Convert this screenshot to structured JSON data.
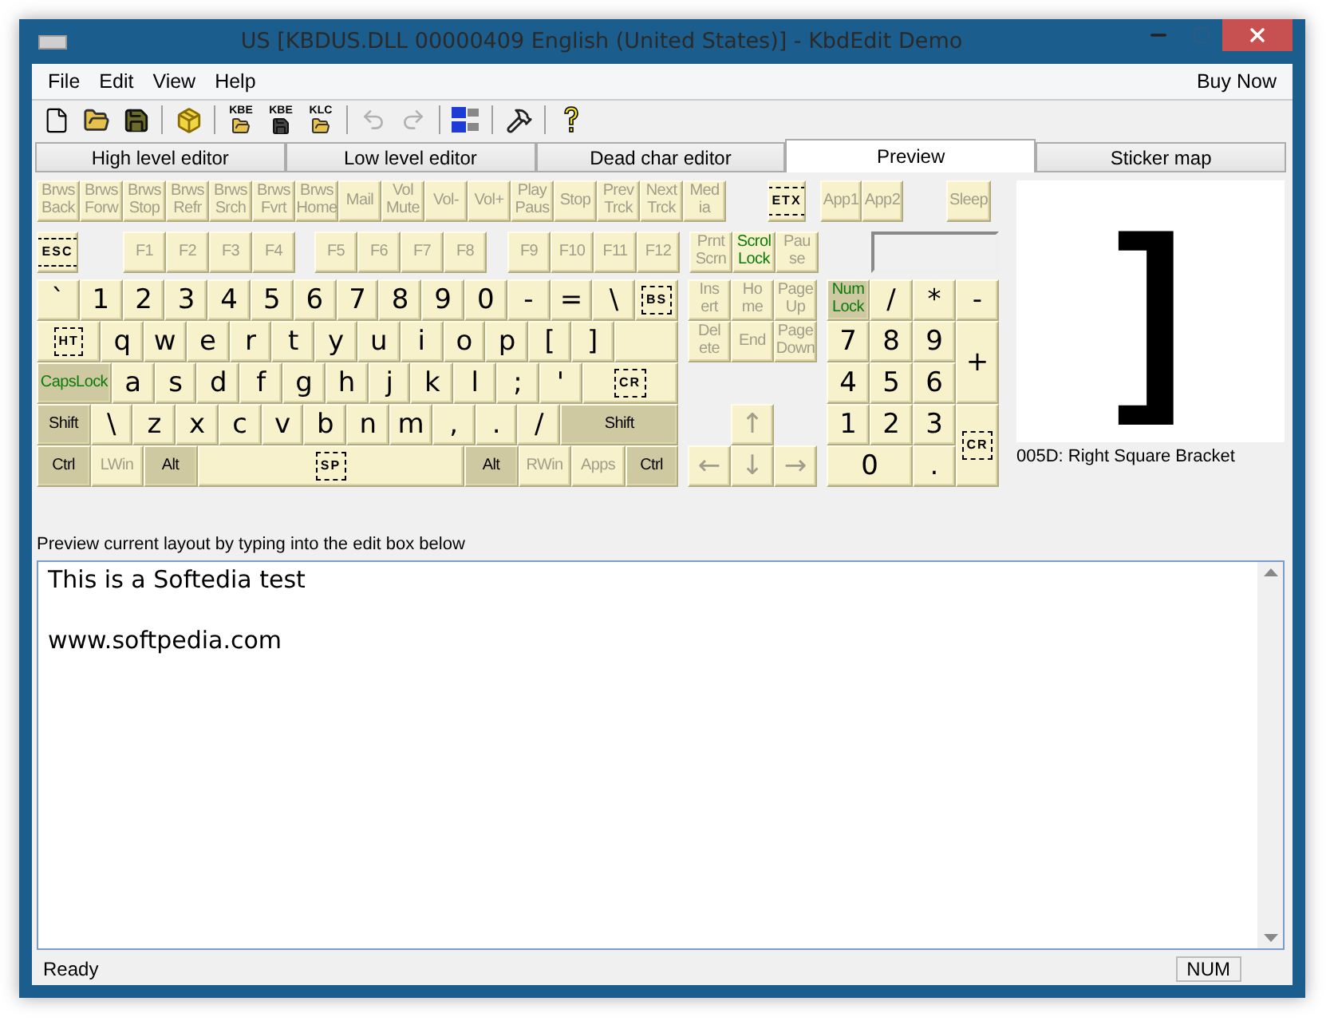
{
  "window": {
    "title": "US [KBDUS.DLL 00000409 English (United States)] - KbdEdit Demo"
  },
  "menu": [
    {
      "label": "File"
    },
    {
      "label": "Edit"
    },
    {
      "label": "View"
    },
    {
      "label": "Help"
    }
  ],
  "buy_now": "Buy Now",
  "toolbar": [
    {
      "kind": "new",
      "disabled": false
    },
    {
      "kind": "open",
      "disabled": false
    },
    {
      "kind": "save",
      "disabled": false
    },
    {
      "kind": "separator"
    },
    {
      "kind": "package",
      "disabled": false
    },
    {
      "kind": "separator"
    },
    {
      "kind": "file-open",
      "label": "KBE",
      "disabled": false
    },
    {
      "kind": "file-save",
      "label": "KBE",
      "disabled": false
    },
    {
      "kind": "file-open",
      "label": "KLC",
      "disabled": false
    },
    {
      "kind": "separator"
    },
    {
      "kind": "undo",
      "disabled": true
    },
    {
      "kind": "redo",
      "disabled": true
    },
    {
      "kind": "separator"
    },
    {
      "kind": "language",
      "disabled": false
    },
    {
      "kind": "separator"
    },
    {
      "kind": "tools",
      "disabled": false
    },
    {
      "kind": "separator"
    },
    {
      "kind": "help",
      "disabled": false
    }
  ],
  "tabs": [
    {
      "label": "High level editor",
      "selected": false
    },
    {
      "label": "Low level editor",
      "selected": false
    },
    {
      "label": "Dead char editor",
      "selected": false
    },
    {
      "label": "Preview",
      "selected": true
    },
    {
      "label": "Sticker map",
      "selected": false
    }
  ],
  "keyboard": {
    "media_row": [
      {
        "label": "Brws Back",
        "kind": "named",
        "dim": true
      },
      {
        "label": "Brws Forw",
        "kind": "named",
        "dim": true
      },
      {
        "label": "Brws Stop",
        "kind": "named",
        "dim": true
      },
      {
        "label": "Brws Refr",
        "kind": "named",
        "dim": true
      },
      {
        "label": "Brws Srch",
        "kind": "named",
        "dim": true
      },
      {
        "label": "Brws Fvrt",
        "kind": "named",
        "dim": true
      },
      {
        "label": "Brws Home",
        "kind": "named",
        "dim": true
      },
      {
        "label": "Mail",
        "kind": "named",
        "dim": true
      },
      {
        "label": "Vol Mute",
        "kind": "named",
        "dim": true
      },
      {
        "label": "Vol-",
        "kind": "named",
        "dim": true
      },
      {
        "label": "Vol+",
        "kind": "named",
        "dim": true
      },
      {
        "label": "Play Paus",
        "kind": "named",
        "dim": true
      },
      {
        "label": "Stop",
        "kind": "named",
        "dim": true
      },
      {
        "label": "Prev Trck",
        "kind": "named",
        "dim": true
      },
      {
        "label": "Next Trck",
        "kind": "named",
        "dim": true
      },
      {
        "label": "Med ia",
        "kind": "named",
        "dim": true
      },
      {
        "label": "ETX",
        "kind": "control",
        "dim": false
      },
      {
        "label": "App1",
        "kind": "named",
        "dim": true
      },
      {
        "label": "App2",
        "kind": "named",
        "dim": true
      },
      {
        "label": "Sleep",
        "kind": "named",
        "dim": true
      }
    ],
    "function_row": [
      {
        "label": "ESC",
        "kind": "control",
        "dim": false
      },
      {
        "label": "F1",
        "kind": "named",
        "dim": true
      },
      {
        "label": "F2",
        "kind": "named",
        "dim": true
      },
      {
        "label": "F3",
        "kind": "named",
        "dim": true
      },
      {
        "label": "F4",
        "kind": "named",
        "dim": true
      },
      {
        "label": "F5",
        "kind": "named",
        "dim": true
      },
      {
        "label": "F6",
        "kind": "named",
        "dim": true
      },
      {
        "label": "F7",
        "kind": "named",
        "dim": true
      },
      {
        "label": "F8",
        "kind": "named",
        "dim": true
      },
      {
        "label": "F9",
        "kind": "named",
        "dim": true
      },
      {
        "label": "F10",
        "kind": "named",
        "dim": true
      },
      {
        "label": "F11",
        "kind": "named",
        "dim": true
      },
      {
        "label": "F12",
        "kind": "named",
        "dim": true
      },
      {
        "label": "Prnt Scrn",
        "kind": "named",
        "dim": true
      },
      {
        "label": "Scrol Lock",
        "kind": "named",
        "dim": false,
        "lit": true
      },
      {
        "label": "Pau se",
        "kind": "named",
        "dim": true
      }
    ],
    "main_rows": [
      [
        {
          "label": "`",
          "kind": "char",
          "dim": false
        },
        {
          "label": "1",
          "kind": "char",
          "dim": false
        },
        {
          "label": "2",
          "kind": "char",
          "dim": false
        },
        {
          "label": "3",
          "kind": "char",
          "dim": false
        },
        {
          "label": "4",
          "kind": "char",
          "dim": false
        },
        {
          "label": "5",
          "kind": "char",
          "dim": false
        },
        {
          "label": "6",
          "kind": "char",
          "dim": false
        },
        {
          "label": "7",
          "kind": "char",
          "dim": false
        },
        {
          "label": "8",
          "kind": "char",
          "dim": false
        },
        {
          "label": "9",
          "kind": "char",
          "dim": false
        },
        {
          "label": "0",
          "kind": "char",
          "dim": false
        },
        {
          "label": "-",
          "kind": "char",
          "dim": false
        },
        {
          "label": "=",
          "kind": "char",
          "dim": false
        },
        {
          "label": "\\",
          "kind": "char",
          "dim": false
        },
        {
          "label": "BS",
          "kind": "control",
          "dim": false
        }
      ],
      [
        {
          "label": "HT",
          "kind": "control",
          "dim": false
        },
        {
          "label": "q",
          "kind": "char",
          "dim": false
        },
        {
          "label": "w",
          "kind": "char",
          "dim": false
        },
        {
          "label": "e",
          "kind": "char",
          "dim": false
        },
        {
          "label": "r",
          "kind": "char",
          "dim": false
        },
        {
          "label": "t",
          "kind": "char",
          "dim": false
        },
        {
          "label": "y",
          "kind": "char",
          "dim": false
        },
        {
          "label": "u",
          "kind": "char",
          "dim": false
        },
        {
          "label": "i",
          "kind": "char",
          "dim": false
        },
        {
          "label": "o",
          "kind": "char",
          "dim": false
        },
        {
          "label": "p",
          "kind": "char",
          "dim": false
        },
        {
          "label": "[",
          "kind": "char",
          "dim": false
        },
        {
          "label": "]",
          "kind": "char",
          "dim": false
        }
      ],
      [
        {
          "label": "CapsLock",
          "kind": "modifier",
          "dim": false,
          "lit": true
        },
        {
          "label": "a",
          "kind": "char",
          "dim": false
        },
        {
          "label": "s",
          "kind": "char",
          "dim": false
        },
        {
          "label": "d",
          "kind": "char",
          "dim": false
        },
        {
          "label": "f",
          "kind": "char",
          "dim": false
        },
        {
          "label": "g",
          "kind": "char",
          "dim": false
        },
        {
          "label": "h",
          "kind": "char",
          "dim": false
        },
        {
          "label": "j",
          "kind": "char",
          "dim": false
        },
        {
          "label": "k",
          "kind": "char",
          "dim": false
        },
        {
          "label": "l",
          "kind": "char",
          "dim": false
        },
        {
          "label": ";",
          "kind": "char",
          "dim": false
        },
        {
          "label": "'",
          "kind": "char",
          "dim": false
        },
        {
          "label": "CR",
          "kind": "control",
          "dim": false
        }
      ],
      [
        {
          "label": "Shift",
          "kind": "modifier",
          "dim": false
        },
        {
          "label": "\\",
          "kind": "char",
          "dim": false
        },
        {
          "label": "z",
          "kind": "char",
          "dim": false
        },
        {
          "label": "x",
          "kind": "char",
          "dim": false
        },
        {
          "label": "c",
          "kind": "char",
          "dim": false
        },
        {
          "label": "v",
          "kind": "char",
          "dim": false
        },
        {
          "label": "b",
          "kind": "char",
          "dim": false
        },
        {
          "label": "n",
          "kind": "char",
          "dim": false
        },
        {
          "label": "m",
          "kind": "char",
          "dim": false
        },
        {
          "label": ",",
          "kind": "char",
          "dim": false
        },
        {
          "label": ".",
          "kind": "char",
          "dim": false
        },
        {
          "label": "/",
          "kind": "char",
          "dim": false
        },
        {
          "label": "Shift",
          "kind": "modifier",
          "dim": false
        }
      ],
      [
        {
          "label": "Ctrl",
          "kind": "modifier",
          "dim": false
        },
        {
          "label": "LWin",
          "kind": "named",
          "dim": true
        },
        {
          "label": "Alt",
          "kind": "modifier",
          "dim": false
        },
        {
          "label": "SP",
          "kind": "control",
          "dim": false
        },
        {
          "label": "Alt",
          "kind": "modifier",
          "dim": false
        },
        {
          "label": "RWin",
          "kind": "named",
          "dim": true
        },
        {
          "label": "Apps",
          "kind": "named",
          "dim": true
        },
        {
          "label": "Ctrl",
          "kind": "modifier",
          "dim": false
        }
      ]
    ],
    "nav": [
      {
        "label": "Ins ert",
        "kind": "named",
        "dim": true
      },
      {
        "label": "Ho me",
        "kind": "named",
        "dim": true
      },
      {
        "label": "Page Up",
        "kind": "named",
        "dim": true
      },
      {
        "label": "Del ete",
        "kind": "named",
        "dim": true
      },
      {
        "label": "End",
        "kind": "named",
        "dim": true
      },
      {
        "label": "Page Down",
        "kind": "named",
        "dim": true
      }
    ],
    "arrows": [
      {
        "label": "↑",
        "kind": "char",
        "dim": true
      },
      {
        "label": "←",
        "kind": "char",
        "dim": true
      },
      {
        "label": "↓",
        "kind": "char",
        "dim": true
      },
      {
        "label": "→",
        "kind": "char",
        "dim": true
      }
    ],
    "numpad": [
      {
        "label": "Num Lock",
        "kind": "modifier",
        "dim": false,
        "lit": true
      },
      {
        "label": "/",
        "kind": "char",
        "dim": false
      },
      {
        "label": "*",
        "kind": "char",
        "dim": false
      },
      {
        "label": "-",
        "kind": "char",
        "dim": false
      },
      {
        "label": "7",
        "kind": "char",
        "dim": false
      },
      {
        "label": "8",
        "kind": "char",
        "dim": false
      },
      {
        "label": "9",
        "kind": "char",
        "dim": false
      },
      {
        "label": "+",
        "kind": "char",
        "dim": false
      },
      {
        "label": "4",
        "kind": "char",
        "dim": false
      },
      {
        "label": "5",
        "kind": "char",
        "dim": false
      },
      {
        "label": "6",
        "kind": "char",
        "dim": false
      },
      {
        "label": "1",
        "kind": "char",
        "dim": false
      },
      {
        "label": "2",
        "kind": "char",
        "dim": false
      },
      {
        "label": "3",
        "kind": "char",
        "dim": false
      },
      {
        "label": "CR",
        "kind": "control",
        "dim": false
      },
      {
        "label": "0",
        "kind": "char",
        "dim": false
      },
      {
        "label": ".",
        "kind": "char",
        "dim": false
      }
    ]
  },
  "preview": {
    "glyph": "]",
    "caption": "005D: Right Square Bracket"
  },
  "hint": "Preview current layout by typing into the edit box below",
  "editor": {
    "value": "This is a Softedia test\n\nwww.softpedia.com"
  },
  "status_bar": {
    "message": "Ready",
    "indicator": "NUM"
  }
}
